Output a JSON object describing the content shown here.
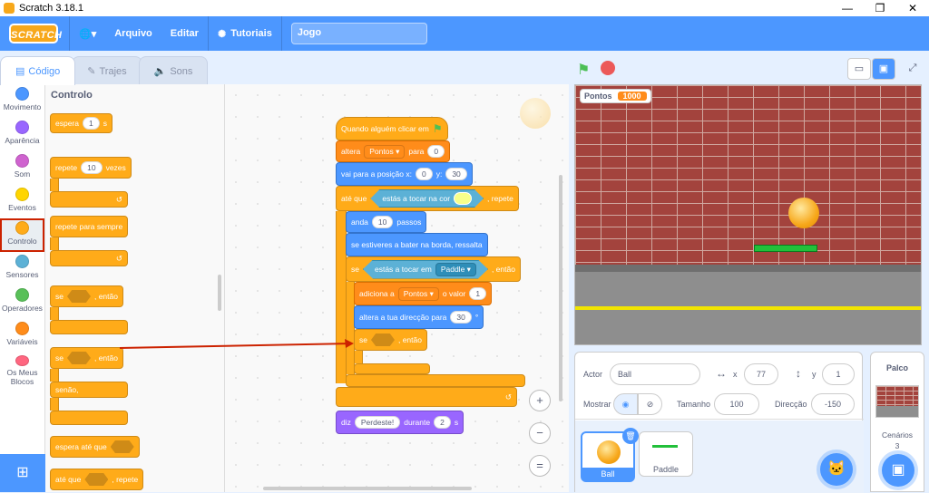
{
  "window": {
    "title": "Scratch 3.18.1",
    "minimize": "—",
    "restore": "❐",
    "close": "✕"
  },
  "menu": {
    "logo": "SCRATCH",
    "language_icon": "🌐▾",
    "file": "Arquivo",
    "edit": "Editar",
    "tutorials": "Tutoriais",
    "project_title": "Jogo"
  },
  "tabs": {
    "code": "Código",
    "costumes": "Trajes",
    "sounds": "Sons"
  },
  "categories": [
    {
      "label": "Movimento",
      "color": "#4c97ff"
    },
    {
      "label": "Aparência",
      "color": "#9966ff"
    },
    {
      "label": "Som",
      "color": "#cf63cf"
    },
    {
      "label": "Eventos",
      "color": "#ffd500"
    },
    {
      "label": "Controlo",
      "color": "#ffab19"
    },
    {
      "label": "Sensores",
      "color": "#5cb1d6"
    },
    {
      "label": "Operadores",
      "color": "#59c059"
    },
    {
      "label": "Variáveis",
      "color": "#ff8c1a"
    },
    {
      "label": "Os Meus Blocos",
      "color": "#ff6680"
    }
  ],
  "palette": {
    "title": "Controlo",
    "wait": {
      "text": "espera",
      "value": "1",
      "unit": "s"
    },
    "repeat": {
      "text": "repete",
      "value": "10",
      "unit": "vezes"
    },
    "forever": "repete para sempre",
    "if_then": {
      "if": "se",
      "then": ", então"
    },
    "if_else": {
      "if": "se",
      "then": ", então",
      "else": "senão,"
    },
    "wait_until": "espera até que",
    "repeat_until": {
      "text": "até que",
      "suffix": ", repete"
    }
  },
  "script": {
    "hat": "Quando alguém clicar em",
    "set_var": {
      "text": "altera",
      "var": "Pontos ▾",
      "to": "para",
      "value": "0"
    },
    "goto": {
      "text": "vai para a posição x:",
      "x": "0",
      "y_label": "y:",
      "y": "30"
    },
    "until": {
      "text": "até que",
      "sense": "estás a tocar na cor",
      "suffix": ", repete"
    },
    "move": {
      "text": "anda",
      "value": "10",
      "unit": "passos"
    },
    "bounce": "se estiveres a bater na borda, ressalta",
    "if_paddle": {
      "if": "se",
      "sense": "estás a tocar em",
      "target": "Paddle ▾",
      "then": ", então"
    },
    "change_var": {
      "text": "adiciona a",
      "var": "Pontos ▾",
      "by": "o valor",
      "value": "1"
    },
    "turn": {
      "text": "altera a tua direcção para",
      "value": "30",
      "unit": "°"
    },
    "inner_if": {
      "if": "se",
      "then": ", então"
    },
    "say": {
      "text": "diz",
      "message": "Perdeste!",
      "for": "durante",
      "value": "2",
      "unit": "s"
    }
  },
  "zoom": {
    "in": "+",
    "out": "−",
    "reset": "="
  },
  "stage": {
    "monitor_label": "Pontos",
    "monitor_value": "1000"
  },
  "sprite_info": {
    "actor_label": "Actor",
    "actor": "Ball",
    "x_label": "x",
    "x": "77",
    "y_label": "y",
    "y": "1",
    "show_label": "Mostrar",
    "size_label": "Tamanho",
    "size": "100",
    "direction_label": "Direcção",
    "direction": "-150"
  },
  "sprites": [
    {
      "name": "Ball"
    },
    {
      "name": "Paddle"
    }
  ],
  "stage_pane": {
    "title": "Palco",
    "backdrops_label": "Cenários",
    "backdrops_count": "3"
  }
}
